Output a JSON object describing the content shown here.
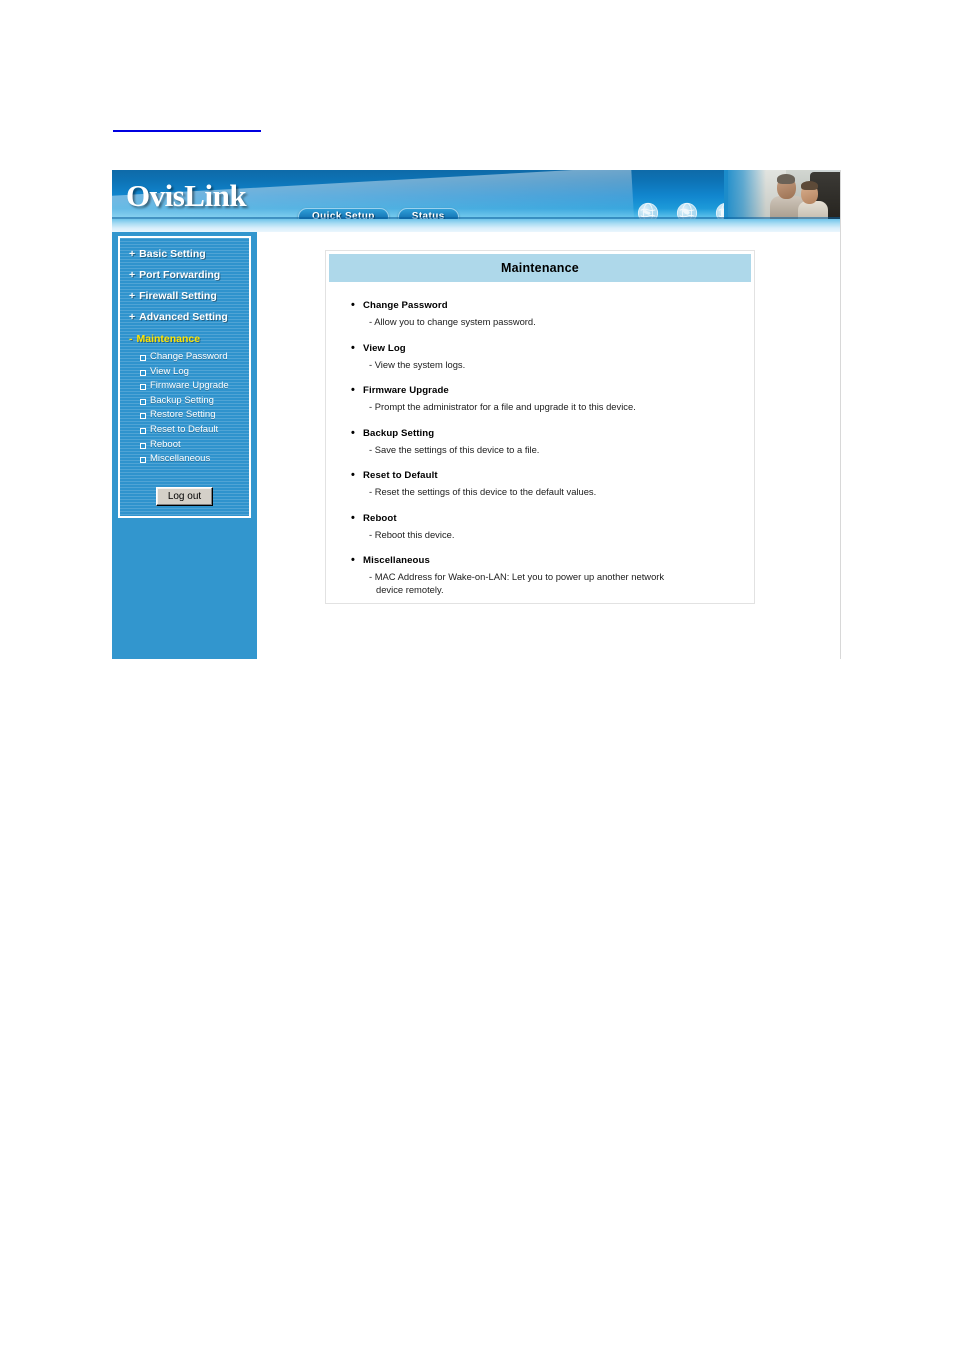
{
  "header": {
    "logo": "OvisLink",
    "nav": [
      {
        "label": "Quick Setup",
        "name": "quick-setup"
      },
      {
        "label": "Status",
        "name": "status"
      }
    ],
    "globe_count": 4
  },
  "sidebar": {
    "top_items": [
      {
        "label": "Basic Setting",
        "marker": "+"
      },
      {
        "label": "Port Forwarding",
        "marker": "+"
      },
      {
        "label": "Firewall Setting",
        "marker": "+"
      },
      {
        "label": "Advanced Setting",
        "marker": "+"
      }
    ],
    "active_item": {
      "label": "Maintenance",
      "marker": "-",
      "color": "#ffe400"
    },
    "sub_items": [
      "Change Password",
      "View Log",
      "Firmware Upgrade",
      "Backup Setting",
      "Restore Setting",
      "Reset to Default",
      "Reboot",
      "Miscellaneous"
    ],
    "logout_label": "Log out",
    "background_color": "#3296ce"
  },
  "content": {
    "panel_title": "Maintenance",
    "title_bar_color": "#aed8ea",
    "entries": [
      {
        "title": "Change Password",
        "desc": "- Allow you to change system password.",
        "desc_cont": ""
      },
      {
        "title": "View Log",
        "desc": "- View the system logs.",
        "desc_cont": ""
      },
      {
        "title": "Firmware Upgrade",
        "desc": "- Prompt the administrator for a file and upgrade it to this device.",
        "desc_cont": ""
      },
      {
        "title": "Backup Setting",
        "desc": "- Save the settings of this device to a file.",
        "desc_cont": ""
      },
      {
        "title": "Reset to Default",
        "desc": "- Reset the settings of this device to the default values.",
        "desc_cont": ""
      },
      {
        "title": "Reboot",
        "desc": "- Reboot this device.",
        "desc_cont": ""
      },
      {
        "title": "Miscellaneous",
        "desc": "- MAC Address for Wake-on-LAN: Let you to power up another network",
        "desc_cont": "device remotely."
      }
    ]
  }
}
